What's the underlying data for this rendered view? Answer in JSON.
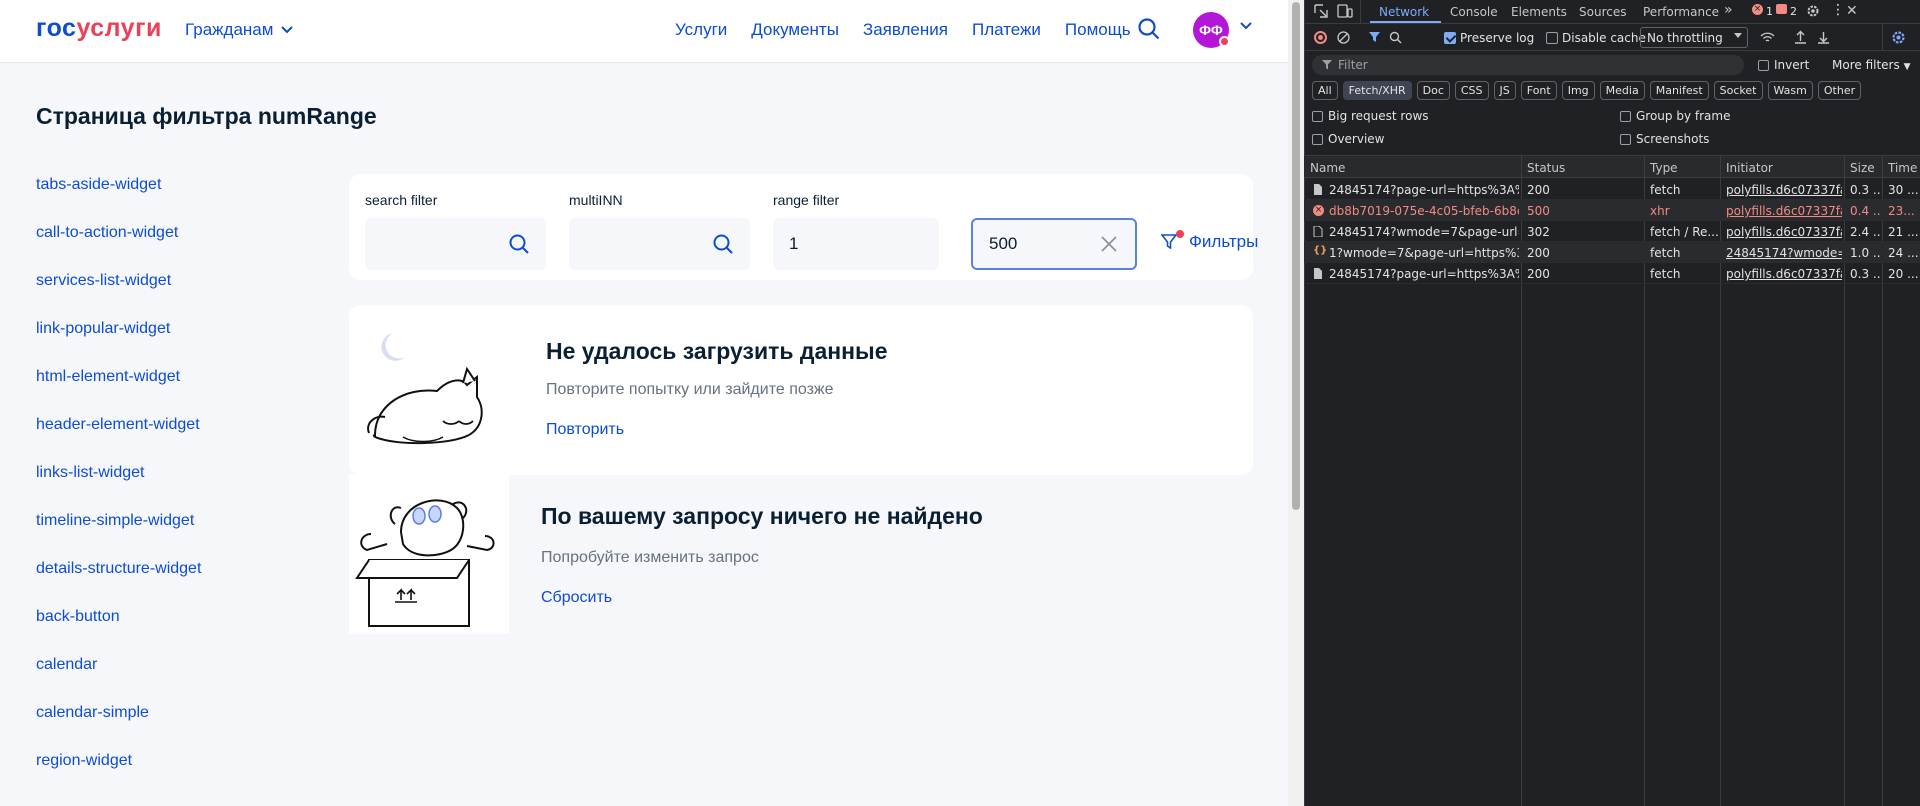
{
  "site": {
    "logo_part1": "гос",
    "logo_part2": "услуги",
    "citizens": "Гражданам",
    "nav": [
      "Услуги",
      "Документы",
      "Заявления",
      "Платежи",
      "Помощь"
    ],
    "avatar_initials": "ФФ",
    "page_title": "Страница фильтра numRange",
    "sidebar": [
      "tabs-aside-widget",
      "call-to-action-widget",
      "services-list-widget",
      "link-popular-widget",
      "html-element-widget",
      "header-element-widget",
      "links-list-widget",
      "timeline-simple-widget",
      "details-structure-widget",
      "back-button",
      "calendar",
      "calendar-simple",
      "region-widget"
    ],
    "filters": {
      "search_label": "search filter",
      "search_value": "",
      "multiinn_label": "multiINN",
      "multiinn_value": "",
      "range_label": "range filter",
      "range_from": "1",
      "range_to": "500",
      "filters_button": "Фильтры"
    },
    "error_card": {
      "title": "Не удалось загрузить данные",
      "subtitle": "Повторите попытку или зайдите позже",
      "action": "Повторить"
    },
    "empty_card": {
      "title": "По вашему запросу ничего не найдено",
      "subtitle": "Попробуйте изменить запрос",
      "action": "Сбросить"
    }
  },
  "devtools": {
    "tabs": [
      "Network",
      "Console",
      "Elements",
      "Sources",
      "Performance"
    ],
    "active_tab": "Network",
    "error_count": "1",
    "warning_count": "2",
    "toolbar": {
      "preserve_log": "Preserve log",
      "disable_cache": "Disable cache",
      "throttling": "No throttling"
    },
    "filter_placeholder": "Filter",
    "invert": "Invert",
    "more_filters": "More filters",
    "chips": [
      "All",
      "Fetch/XHR",
      "Doc",
      "CSS",
      "JS",
      "Font",
      "Img",
      "Media",
      "Manifest",
      "Socket",
      "Wasm",
      "Other"
    ],
    "selected_chip": "Fetch/XHR",
    "options": {
      "big_rows": "Big request rows",
      "group_by_frame": "Group by frame",
      "overview": "Overview",
      "screenshots": "Screenshots"
    },
    "columns": [
      "Name",
      "Status",
      "Type",
      "Initiator",
      "Size",
      "Time"
    ],
    "rows": [
      {
        "name": "24845174?page-url=https%3A%2...",
        "status": "200",
        "type": "fetch",
        "initiator": "polyfills.d6c07337fa68",
        "size": "0.3 ...",
        "time": "30 ..."
      },
      {
        "name": "db8b7019-075e-4c05-bfeb-6b8c0...",
        "status": "500",
        "type": "xhr",
        "initiator": "polyfills.d6c07337fa68",
        "size": "0.4 ...",
        "time": "23..."
      },
      {
        "name": "24845174?wmode=7&page-url=h...",
        "status": "302",
        "type": "fetch / Re...",
        "initiator": "polyfills.d6c07337fa68",
        "size": "2.4 ...",
        "time": "21 ..."
      },
      {
        "name": "1?wmode=7&page-url=https%3A...",
        "status": "200",
        "type": "fetch",
        "initiator": "24845174?wmode=78",
        "size": "1.0 ...",
        "time": "24 ..."
      },
      {
        "name": "24845174?page-url=https%3A%2...",
        "status": "200",
        "type": "fetch",
        "initiator": "polyfills.d6c07337fa68",
        "size": "0.3 ...",
        "time": "20 ..."
      }
    ]
  }
}
